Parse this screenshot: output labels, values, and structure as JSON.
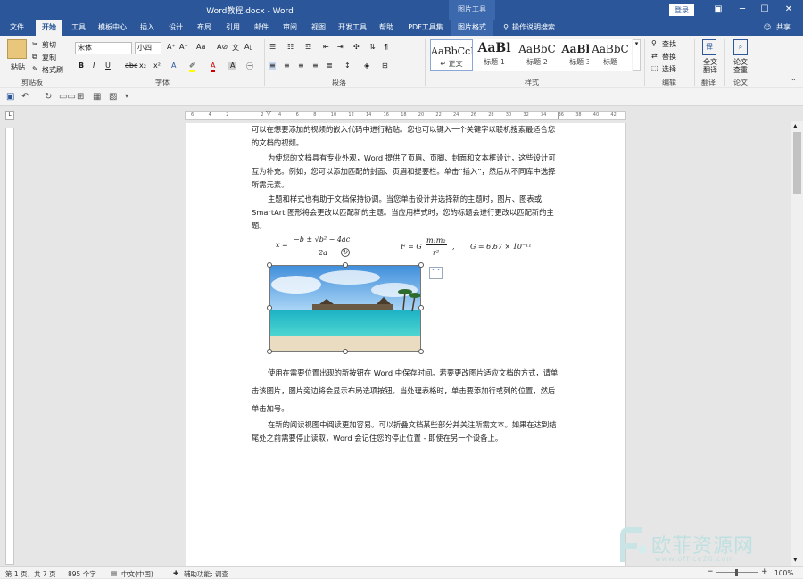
{
  "window": {
    "title": "Word教程.docx - Word",
    "context_title": "图片工具",
    "login": "登录"
  },
  "tabs": [
    "文件",
    "开始",
    "工具",
    "模板中心",
    "插入",
    "设计",
    "布局",
    "引用",
    "邮件",
    "审阅",
    "视图",
    "开发工具",
    "帮助",
    "PDF工具集",
    "图片格式"
  ],
  "tell_me": "操作说明搜索",
  "share": "共享",
  "ribbon": {
    "clipboard": {
      "paste": "粘贴",
      "cut": "剪切",
      "copy": "复制",
      "format_painter": "格式刷",
      "label": "剪贴板"
    },
    "font": {
      "name": "宋体",
      "size": "小四",
      "bold": "B",
      "italic": "I",
      "underline": "U",
      "strike": "abc",
      "sub": "x₂",
      "sup": "x²",
      "label": "字体"
    },
    "paragraph": {
      "label": "段落"
    },
    "styles": {
      "label": "样式",
      "items": [
        {
          "sample": "AaBbCcI",
          "name": "↵ 正文"
        },
        {
          "sample": "AaBl",
          "name": "标题 1"
        },
        {
          "sample": "AaBbC",
          "name": "标题 2"
        },
        {
          "sample": "AaBb(",
          "name": "标题 3"
        },
        {
          "sample": "AaBbC",
          "name": "标题"
        }
      ]
    },
    "editing": {
      "find": "查找",
      "replace": "替换",
      "select": "选择",
      "label": "编辑"
    },
    "translate": {
      "button": "全文翻译",
      "label": "翻译"
    },
    "paper": {
      "button": "论文查重",
      "label": "论文"
    }
  },
  "document": {
    "p1": "可以在想要添加的视频的嵌入代码中进行粘贴。您也可以键入一个关键字以联机搜索最适合您的文档的视频。",
    "p2": "为使您的文档具有专业外观，Word 提供了页眉、页脚、封面和文本框设计，这些设计可互为补充。例如，您可以添加匹配的封面、页眉和提要栏。单击“插入”，然后从不同库中选择所需元素。",
    "p3": "主题和样式也有助于文档保持协调。当您单击设计并选择新的主题时，图片、图表或 SmartArt 图形将会更改以匹配新的主题。当应用样式时，您的标题会进行更改以匹配新的主题。",
    "formula1_num": "−b ± √b² − 4ac",
    "formula1_lhs": "x =",
    "formula1_den": "2a",
    "formula2_lhs": "F = G",
    "formula2_num": "m₁m₂",
    "formula2_den": "r²",
    "formula3": "G = 6.67 × 10⁻¹¹",
    "p4": "使用在需要位置出现的新按钮在 Word 中保存时间。若要更改图片适应文档的方式，请单击该图片，图片旁边将会显示布局选项按钮。当处理表格时，单击要添加行或列的位置，然后单击加号。",
    "p5": "在新的阅读视图中阅读更加容易。可以折叠文档某些部分并关注所需文本。如果在达到结尾处之前需要停止读取，Word 会记住您的停止位置 - 即使在另一个设备上。"
  },
  "status": {
    "page": "第 1 页，共 7 页",
    "words": "895 个字",
    "lang": "中文(中国)",
    "accessibility": "辅助功能: 调查",
    "zoom": "100%"
  },
  "ruler_ticks": [
    "6",
    "4",
    "2",
    "",
    "2",
    "4",
    "6",
    "8",
    "10",
    "12",
    "14",
    "16",
    "18",
    "20",
    "22",
    "24",
    "26",
    "28",
    "30",
    "32",
    "34",
    "36",
    "38",
    "40",
    "42"
  ],
  "watermark": {
    "text": "欧菲资源网",
    "url": "www.office26.com"
  }
}
